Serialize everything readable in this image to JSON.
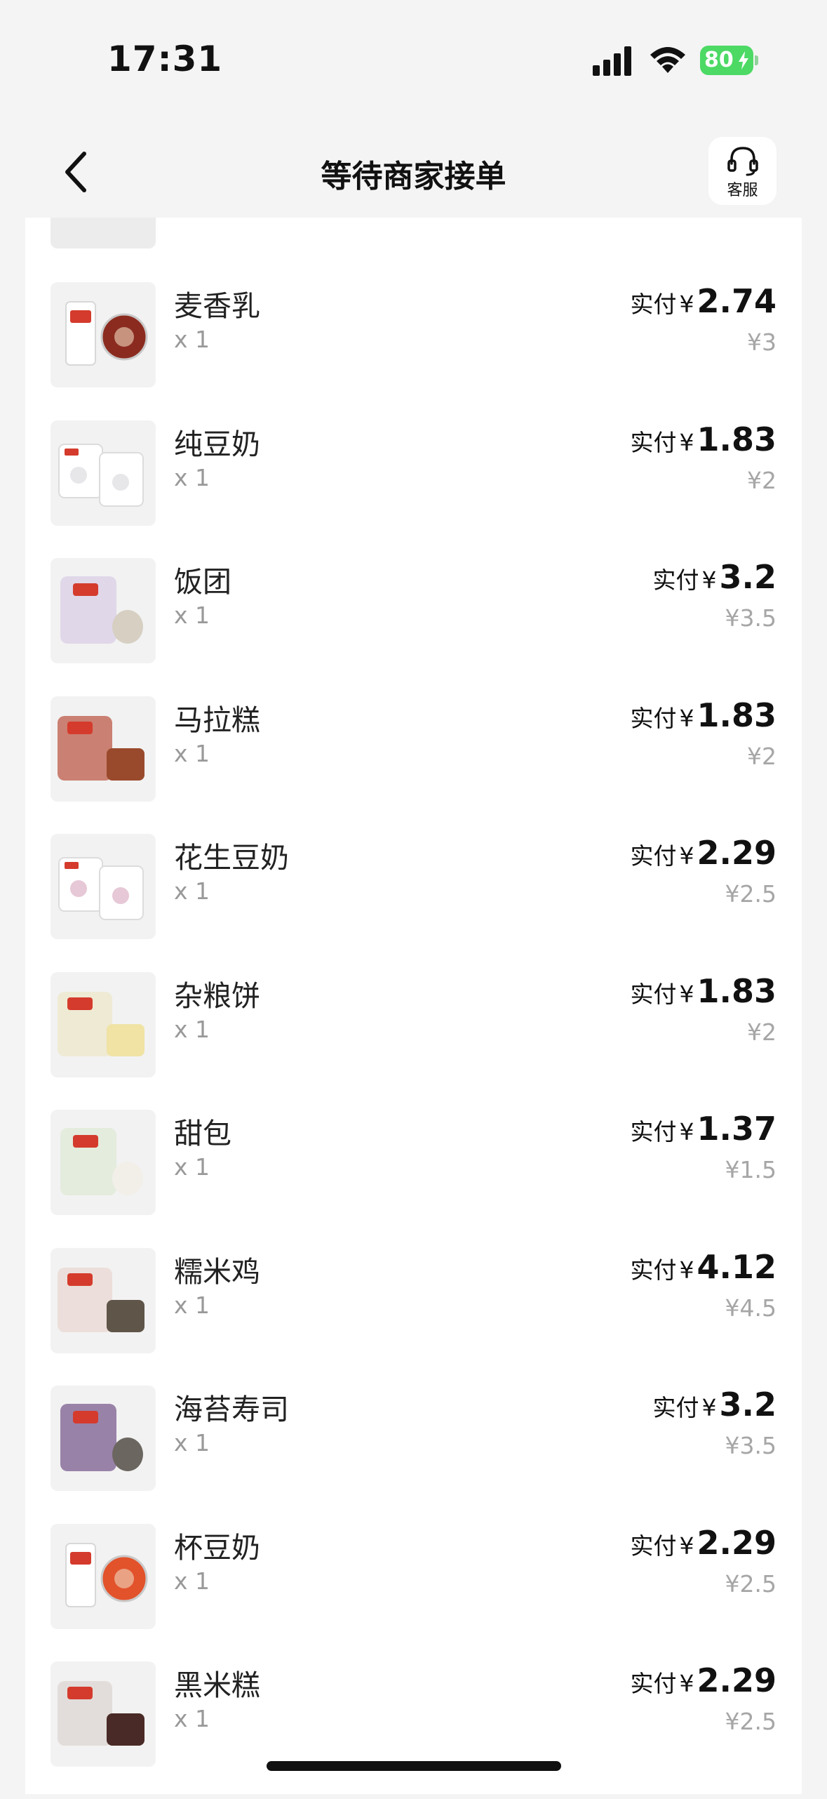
{
  "status_bar": {
    "time": "17:31",
    "battery": "80"
  },
  "nav": {
    "title": "等待商家接单",
    "service_label": "客服"
  },
  "colors": {
    "battery_green": "#4cd964",
    "original_price_gray": "#a6a6a6"
  },
  "items": [
    {
      "name": "麦香乳",
      "qty": "x 1",
      "pay_label": "实付",
      "currency": "¥",
      "pay": "2.74",
      "original": "¥3",
      "thumb": {
        "bag": "#f3f3f3",
        "food": "#8b2b1f",
        "type": "cup-with-lid"
      }
    },
    {
      "name": "纯豆奶",
      "qty": "x 1",
      "pay_label": "实付",
      "currency": "¥",
      "pay": "1.83",
      "original": "¥2",
      "thumb": {
        "bag": "#f5f5f5",
        "food": "#e7e7ea",
        "type": "two-bags"
      }
    },
    {
      "name": "饭团",
      "qty": "x 1",
      "pay_label": "实付",
      "currency": "¥",
      "pay": "3.2",
      "original": "¥3.5",
      "thumb": {
        "bag": "#d9cde6",
        "food": "#d6cfc2",
        "type": "bag-and-ball"
      }
    },
    {
      "name": "马拉糕",
      "qty": "x 1",
      "pay_label": "实付",
      "currency": "¥",
      "pay": "1.83",
      "original": "¥2",
      "thumb": {
        "bag": "#b9503c",
        "food": "#9a4a2c",
        "type": "bag-and-cake"
      }
    },
    {
      "name": "花生豆奶",
      "qty": "x 1",
      "pay_label": "实付",
      "currency": "¥",
      "pay": "2.29",
      "original": "¥2.5",
      "thumb": {
        "bag": "#f5f5f5",
        "food": "#e7c8d6",
        "type": "two-bags"
      }
    },
    {
      "name": "杂粮饼",
      "qty": "x 1",
      "pay_label": "实付",
      "currency": "¥",
      "pay": "1.83",
      "original": "¥2",
      "thumb": {
        "bag": "#eee7c8",
        "food": "#f0e3a4",
        "type": "bag-and-cake"
      }
    },
    {
      "name": "甜包",
      "qty": "x 1",
      "pay_label": "实付",
      "currency": "¥",
      "pay": "1.37",
      "original": "¥1.5",
      "thumb": {
        "bag": "#dfe9d5",
        "food": "#f1efe8",
        "type": "bag-and-ball"
      }
    },
    {
      "name": "糯米鸡",
      "qty": "x 1",
      "pay_label": "实付",
      "currency": "¥",
      "pay": "4.12",
      "original": "¥4.5",
      "thumb": {
        "bag": "#e9d6d0",
        "food": "#5f5548",
        "type": "bag-and-cake"
      }
    },
    {
      "name": "海苔寿司",
      "qty": "x 1",
      "pay_label": "实付",
      "currency": "¥",
      "pay": "3.2",
      "original": "¥3.5",
      "thumb": {
        "bag": "#7b5c8f",
        "food": "#6b665f",
        "type": "bag-and-ball"
      }
    },
    {
      "name": "杯豆奶",
      "qty": "x 1",
      "pay_label": "实付",
      "currency": "¥",
      "pay": "2.29",
      "original": "¥2.5",
      "thumb": {
        "bag": "#f3f3f3",
        "food": "#e2522b",
        "type": "cup-with-lid"
      }
    },
    {
      "name": "黑米糕",
      "qty": "x 1",
      "pay_label": "实付",
      "currency": "¥",
      "pay": "2.29",
      "original": "¥2.5",
      "thumb": {
        "bag": "#dcd4d0",
        "food": "#4a2a26",
        "type": "bag-and-cake"
      }
    }
  ]
}
